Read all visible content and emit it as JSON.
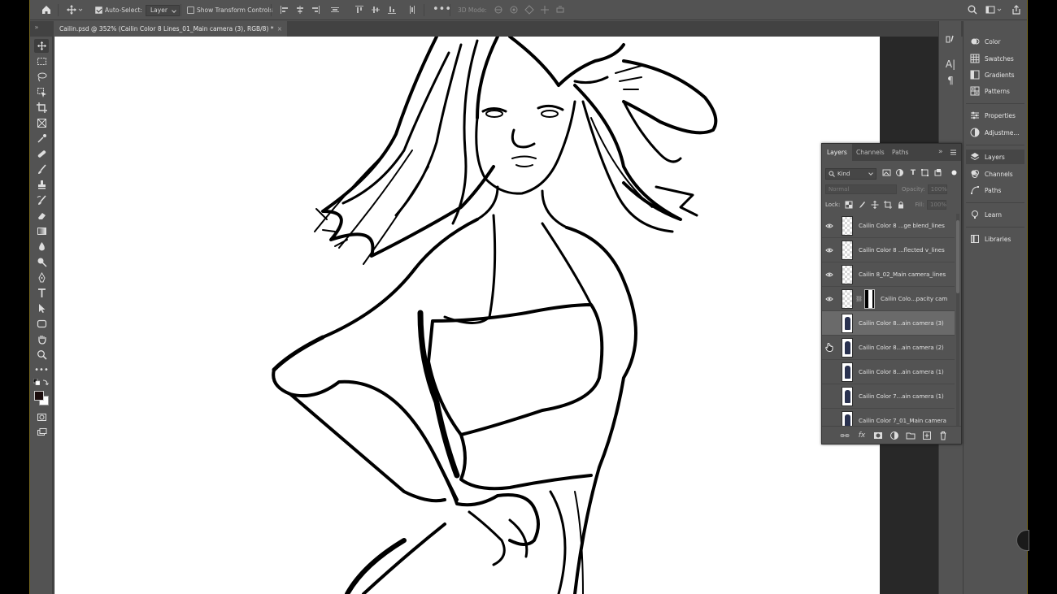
{
  "options_bar": {
    "home_icon": "home-icon",
    "move_tool_icon": "move-tool-icon",
    "auto_select_label": "Auto-Select:",
    "auto_select_checked": true,
    "auto_select_target": "Layer",
    "show_transform_label": "Show Transform Controls",
    "show_transform_checked": false,
    "more_icon": "ellipsis-icon",
    "mode_3d_label": "3D Mode:",
    "search_icon": "search-icon",
    "workspace_icon": "workspace-icon",
    "share_icon": "share-icon"
  },
  "document": {
    "tab_title": "Cailin.psd @ 352% (Cailin Color 8 Lines_01_Main camera (3), RGB/8) *",
    "close_glyph": "×"
  },
  "toolbar": {
    "tools": [
      "move",
      "marquee",
      "lasso",
      "object-select",
      "crop",
      "frame",
      "eyedropper",
      "healing",
      "brush",
      "clone-stamp",
      "history-brush",
      "eraser",
      "gradient",
      "blur",
      "dodge",
      "pen",
      "type",
      "path-select",
      "rectangle",
      "hand",
      "zoom",
      "more"
    ],
    "foreground_color": "#1a0c0c",
    "background_color": "#ffffff"
  },
  "right_dock": {
    "items": [
      {
        "label": "Color",
        "icon": "color-icon"
      },
      {
        "label": "Swatches",
        "icon": "swatches-icon"
      },
      {
        "label": "Gradients",
        "icon": "gradients-icon"
      },
      {
        "label": "Patterns",
        "icon": "patterns-icon"
      },
      {
        "label": "Properties",
        "icon": "properties-icon"
      },
      {
        "label": "Adjustme...",
        "icon": "adjustments-icon"
      },
      {
        "label": "Layers",
        "icon": "layers-icon"
      },
      {
        "label": "Channels",
        "icon": "channels-icon"
      },
      {
        "label": "Paths",
        "icon": "paths-icon"
      },
      {
        "label": "Learn",
        "icon": "learn-icon"
      },
      {
        "label": "Libraries",
        "icon": "libraries-icon"
      }
    ]
  },
  "layers_panel": {
    "tabs": [
      "Layers",
      "Channels",
      "Paths"
    ],
    "active_tab": "Layers",
    "filter_kind": "Kind",
    "blend_mode": "Normal",
    "opacity_label": "Opacity:",
    "opacity_value": "100%",
    "lock_label": "Lock:",
    "fill_label": "Fill:",
    "fill_value": "100%",
    "layers": [
      {
        "name": "Cailin Color 8 ...ge blend_lines",
        "visible": true,
        "selected": false,
        "thumb": "transparent"
      },
      {
        "name": "Cailin Color 8 ...flected v_lines",
        "visible": true,
        "selected": false,
        "thumb": "transparent"
      },
      {
        "name": "Cailin 8_02_Main camera_lines",
        "visible": true,
        "selected": false,
        "thumb": "transparent"
      },
      {
        "name": "Cailin Colo...pacity cam",
        "visible": true,
        "selected": false,
        "thumb": "transparent",
        "has_mask": true
      },
      {
        "name": "Cailin Color 8...ain camera (3)",
        "visible": false,
        "selected": true,
        "thumb": "figure"
      },
      {
        "name": "Cailin Color 8...ain camera (2)",
        "visible": false,
        "selected": false,
        "thumb": "figure"
      },
      {
        "name": "Cailin Color 8...ain camera (1)",
        "visible": false,
        "selected": false,
        "thumb": "figure"
      },
      {
        "name": "Cailin Color 7...ain camera (1)",
        "visible": false,
        "selected": false,
        "thumb": "figure"
      },
      {
        "name": "Cailin Color 7_01_Main camera",
        "visible": false,
        "selected": false,
        "thumb": "figure"
      }
    ]
  }
}
